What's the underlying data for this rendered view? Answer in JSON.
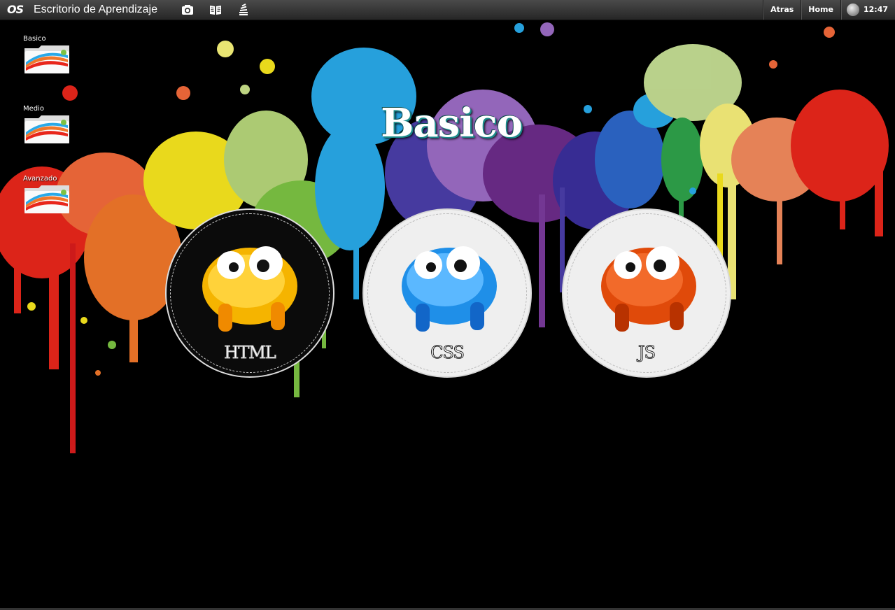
{
  "topbar": {
    "logo": "OS",
    "title": "Escritorio de Aprendizaje",
    "icons": [
      "camera-icon",
      "book-icon",
      "stack-icon"
    ],
    "back_label": "Atras",
    "home_label": "Home",
    "time": "12:47"
  },
  "desktop": {
    "items": [
      {
        "label": "Basico",
        "icon": "folder-icon"
      },
      {
        "label": "Medio",
        "icon": "folder-icon"
      },
      {
        "label": "Avanzado",
        "icon": "folder-icon"
      }
    ]
  },
  "main": {
    "title": "Basico",
    "courses": [
      {
        "label": "HTML",
        "color": "#f5b400",
        "selected": true
      },
      {
        "label": "CSS",
        "color": "#1f8fe8",
        "selected": false
      },
      {
        "label": "JS",
        "color": "#e04a0a",
        "selected": false
      }
    ]
  },
  "colors": {
    "topbar": "#3a3a3a",
    "background": "#000000"
  }
}
